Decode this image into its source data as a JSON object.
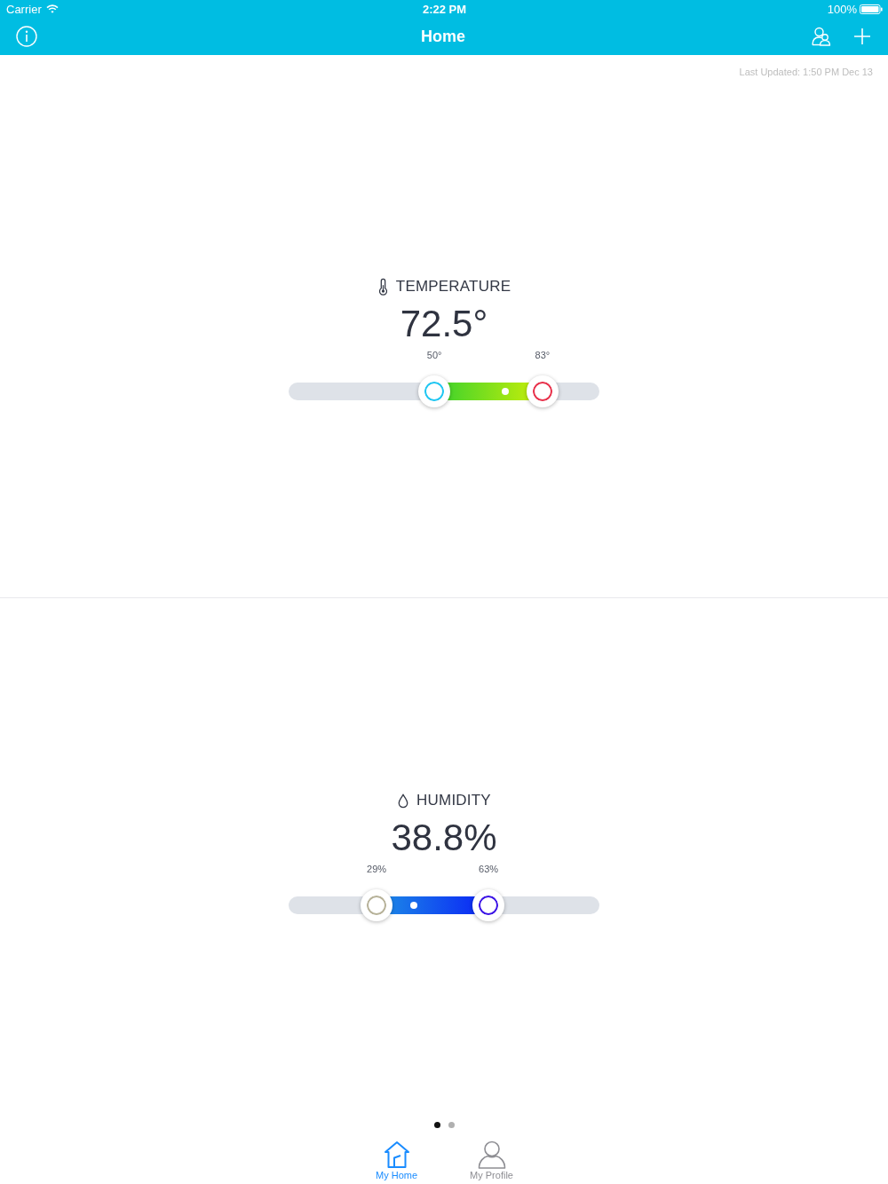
{
  "status_bar": {
    "carrier": "Carrier",
    "time": "2:22 PM",
    "battery": "100%"
  },
  "nav_bar": {
    "title": "Home"
  },
  "last_updated": "Last Updated: 1:50 PM Dec 13",
  "sensors": [
    {
      "kind": "temperature",
      "label": "TEMPERATURE",
      "reading": "72.5°",
      "low": {
        "label": "50°",
        "level": 0.469
      },
      "high": {
        "label": "83°",
        "level": 0.817
      },
      "current": {
        "level": 0.697
      }
    },
    {
      "kind": "humidity",
      "label": "HUMIDITY",
      "reading": "38.8%",
      "low": {
        "label": "29%",
        "level": 0.283
      },
      "high": {
        "label": "63%",
        "level": 0.643
      },
      "current": {
        "level": 0.403
      }
    }
  ],
  "page_dots": [
    {
      "selected": true
    },
    {
      "selected": false
    }
  ],
  "tabs": [
    {
      "kind": "home",
      "label": "My Home",
      "selected": true
    },
    {
      "kind": "profile",
      "label": "My Profile",
      "selected": false
    }
  ]
}
